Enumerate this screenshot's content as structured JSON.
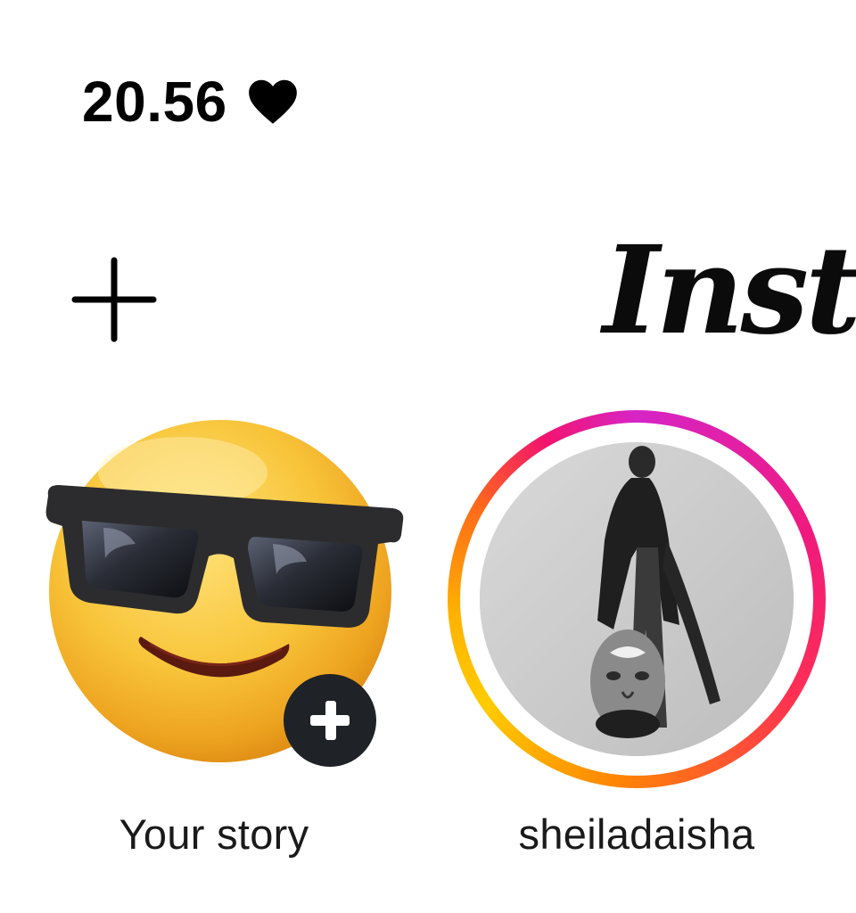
{
  "status_bar": {
    "time": "20.56",
    "status_icon": "heart-icon"
  },
  "header": {
    "logo_text": "Instagram",
    "add_icon": "plus-icon"
  },
  "stories": [
    {
      "label": "Your story",
      "avatar": "sunglasses-emoji",
      "badge_icon": "plus-icon"
    },
    {
      "label": "sheiladaisha",
      "avatar": "profile-photo",
      "ring_colors": [
        "#d625c6",
        "#f01a7c",
        "#ff8a00",
        "#ffcc00"
      ]
    }
  ],
  "colors": {
    "text": "#000000",
    "badge": "#1f2227"
  }
}
